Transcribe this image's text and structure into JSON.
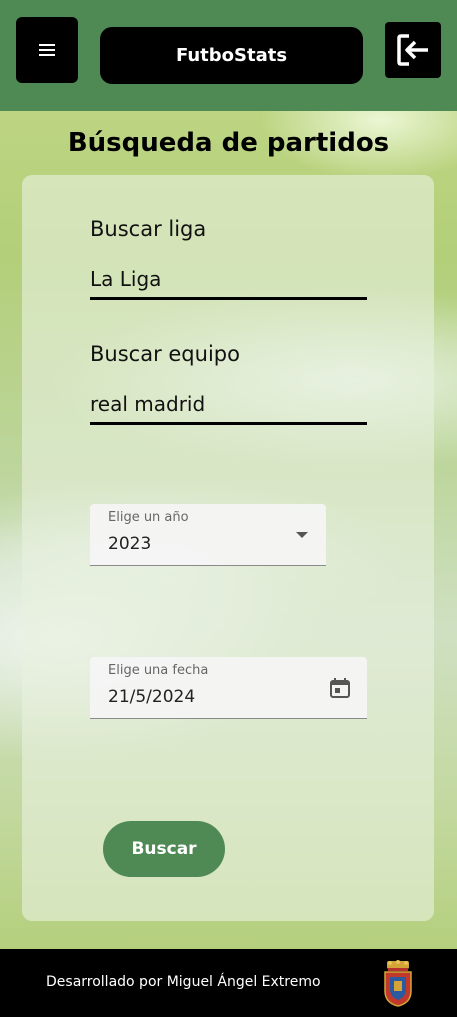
{
  "header": {
    "menu_icon": "hamburger-menu-icon",
    "app_title": "FutboStats",
    "logout_icon": "logout-arrow-icon",
    "color": "#4f8a55"
  },
  "page_title": "Búsqueda de partidos",
  "form": {
    "league": {
      "label": "Buscar liga",
      "value": "La Liga"
    },
    "team": {
      "label": "Buscar equipo",
      "value": "real madrid"
    },
    "year": {
      "label": "Elige un año",
      "value": "2023",
      "icon": "dropdown-arrow-icon"
    },
    "date": {
      "label": "Elige una fecha",
      "value": "21/5/2024",
      "icon": "calendar-icon"
    },
    "search_button": "Buscar"
  },
  "footer": {
    "text": "Desarrollado por Miguel Ángel Extremo",
    "crest_icon": "coat-of-arms-icon"
  }
}
